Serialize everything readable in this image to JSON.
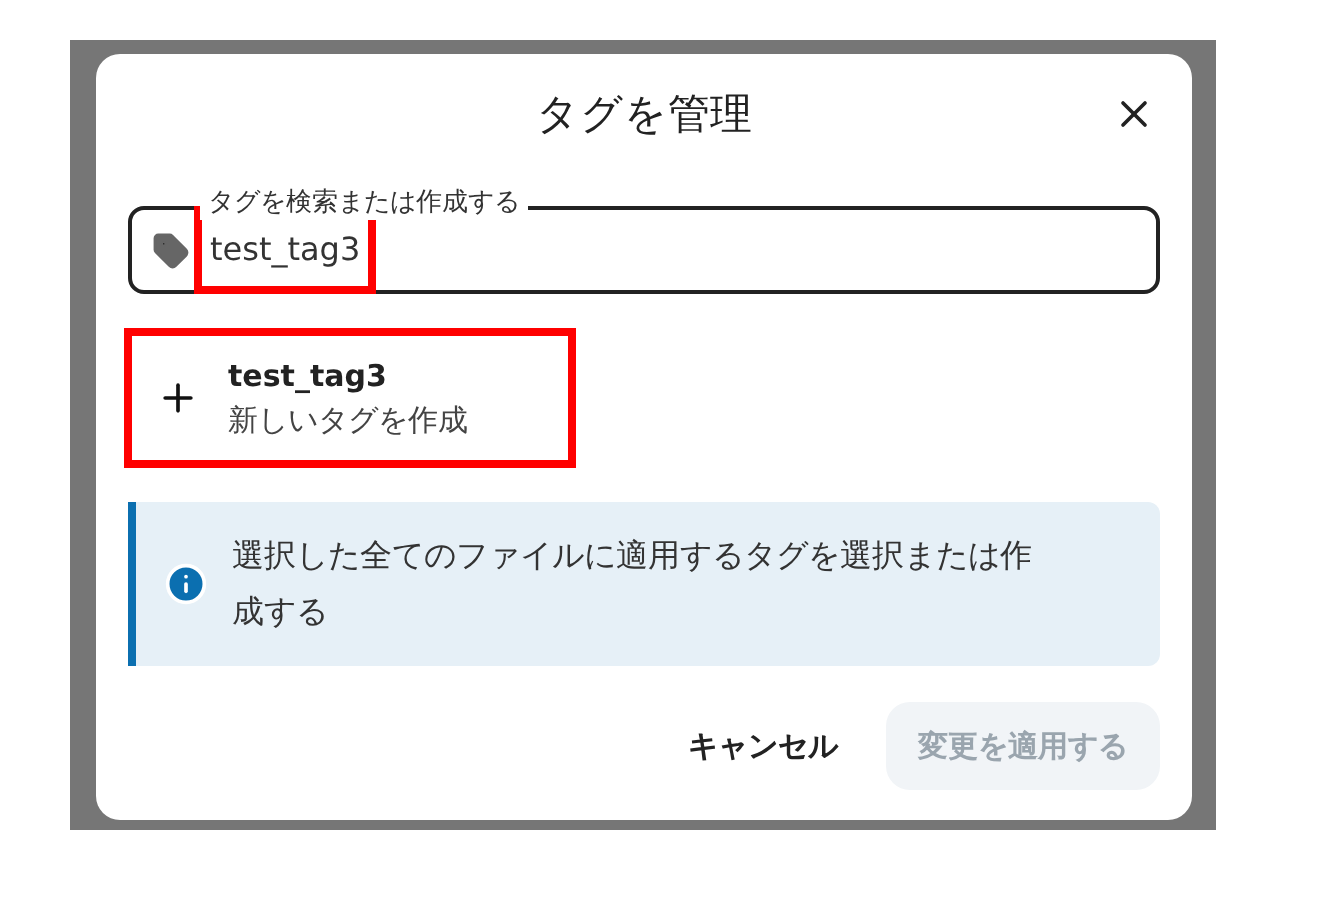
{
  "dialog": {
    "title": "タグを管理"
  },
  "search": {
    "label": "タグを検索または作成する",
    "value": "test_tag3",
    "highlighted": true
  },
  "create_option": {
    "name": "test_tag3",
    "subtitle": "新しいタグを作成",
    "highlighted": true
  },
  "info": {
    "message": "選択した全てのファイルに適用するタグを選択または作成する"
  },
  "buttons": [
    {
      "label": "キャンセル",
      "kind": "text",
      "disabled": false
    },
    {
      "label": "変更を適用する",
      "kind": "filled",
      "disabled": true
    }
  ]
}
